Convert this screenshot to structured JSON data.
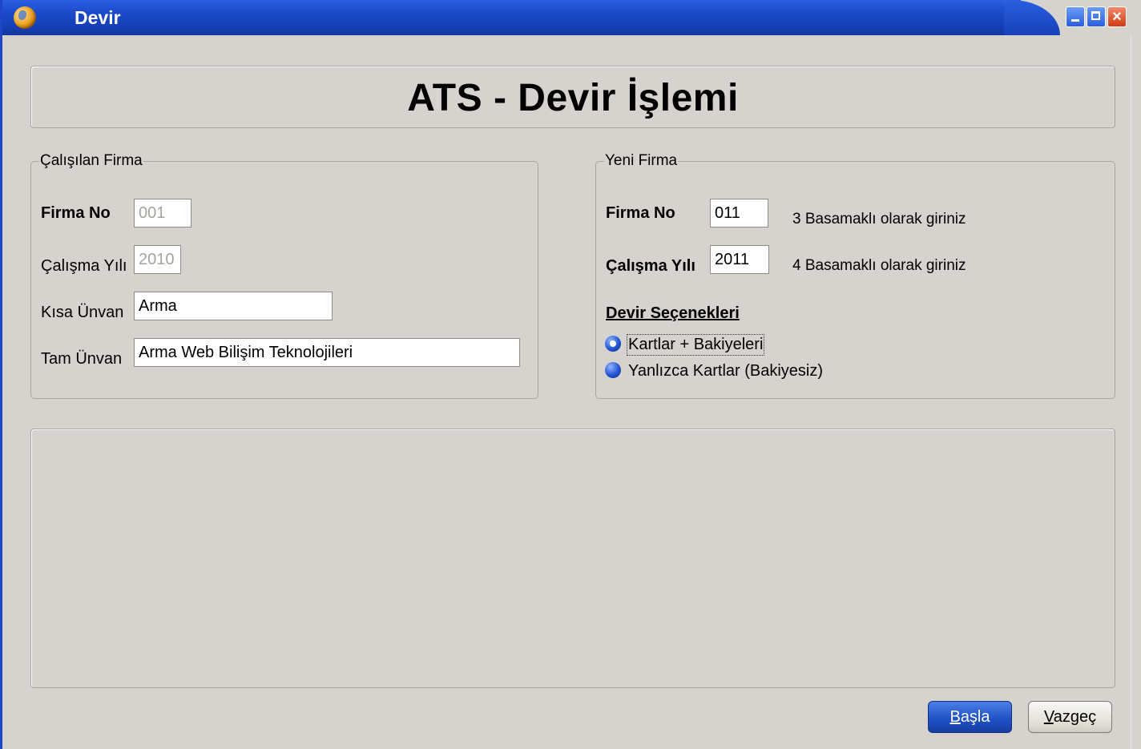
{
  "window": {
    "title": "Devir"
  },
  "header": {
    "title": "ATS - Devir İşlemi"
  },
  "current_company": {
    "legend": "Çalışılan Firma",
    "firma_no_label": "Firma No",
    "firma_no_value": "001",
    "calisma_yili_label": "Çalışma Yılı",
    "calisma_yili_value": "2010",
    "kisa_unvan_label": "Kısa Ünvan",
    "kisa_unvan_value": "Arma",
    "tam_unvan_label": "Tam Ünvan",
    "tam_unvan_value": "Arma Web Bilişim Teknolojileri"
  },
  "new_company": {
    "legend": "Yeni Firma",
    "firma_no_label": "Firma No",
    "firma_no_value": "011",
    "firma_no_hint": "3 Basamaklı olarak giriniz",
    "calisma_yili_label": "Çalışma Yılı",
    "calisma_yili_value": "2011",
    "calisma_yili_hint": "4 Basamaklı olarak giriniz",
    "options_title": "Devir Seçenekleri",
    "options": [
      {
        "label": "Kartlar + Bakiyeleri",
        "checked": true
      },
      {
        "label": "Yanlızca Kartlar (Bakiyesiz)",
        "checked": false
      }
    ]
  },
  "buttons": {
    "start_first": "B",
    "start_rest": "aşla",
    "cancel_first": "V",
    "cancel_rest": "azgeç"
  },
  "colors": {
    "titlebar": "#1a48c8",
    "window_bg": "#d6d3ce",
    "primary_button": "#1e4fc4"
  },
  "icons": {
    "app": "globe-app-icon",
    "minimize": "minimize-icon",
    "maximize": "maximize-icon",
    "close": "close-icon"
  }
}
